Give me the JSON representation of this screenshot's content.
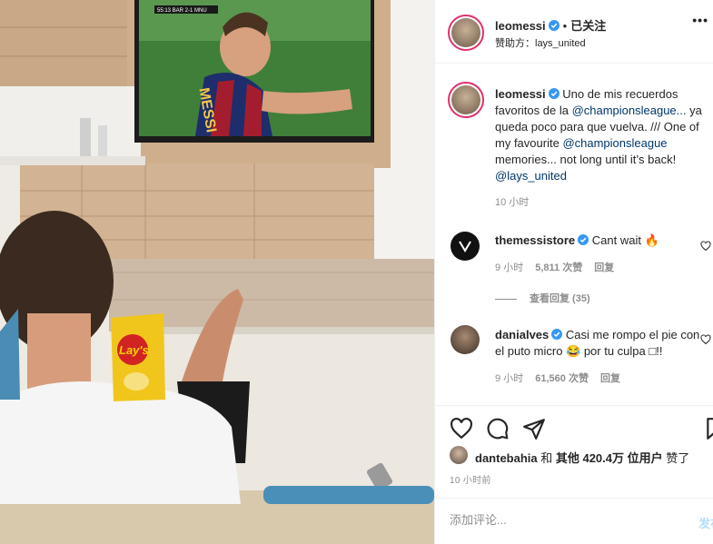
{
  "tv": {
    "scoreboard": "55:13  BAR  2-1  MNU",
    "jersey_text": "MESSI"
  },
  "snack_bag": {
    "brand": "Lay's"
  },
  "header": {
    "username": "leomessi",
    "follow_label": "已关注",
    "dot": "•",
    "sponsor_prefix": "赞助方：",
    "sponsor_name": "lays_united",
    "more_icon": "more-horizontal-icon"
  },
  "caption": {
    "username": "leomessi",
    "text_1": "Uno de mis recuerdos favoritos de la",
    "mention_1": "@championsleague...",
    "text_2": "ya queda poco para que vuelva. /// One of my favourite",
    "mention_2": "@championsleague",
    "text_3": "memories... not long until it’s back!",
    "mention_3": "@lays_united",
    "time": "10 小时"
  },
  "comments": [
    {
      "username": "themessistore",
      "text": "Cant wait 🔥",
      "time": "9 小时",
      "likes": "5,811 次赞",
      "reply_label": "回复"
    },
    {
      "username": "danialves",
      "text": "Casi me rompo el pie con el puto micro 😂 por tu culpa □!!",
      "time": "9 小时",
      "likes": "61,560 次赞",
      "reply_label": "回复"
    }
  ],
  "view_replies": "查看回复 (35)",
  "likes_line": {
    "user": "dantebahia",
    "middle": " 和 ",
    "others": "其他 420.4万 位用户",
    "suffix": " 赞了"
  },
  "posted_time": "10 小时前",
  "add_comment": {
    "placeholder": "添加评论...",
    "post_label": "发布"
  },
  "colors": {
    "accent": "#0095f6",
    "verified": "#3897f0",
    "link": "#00376b",
    "muted": "#8e8e8e"
  }
}
